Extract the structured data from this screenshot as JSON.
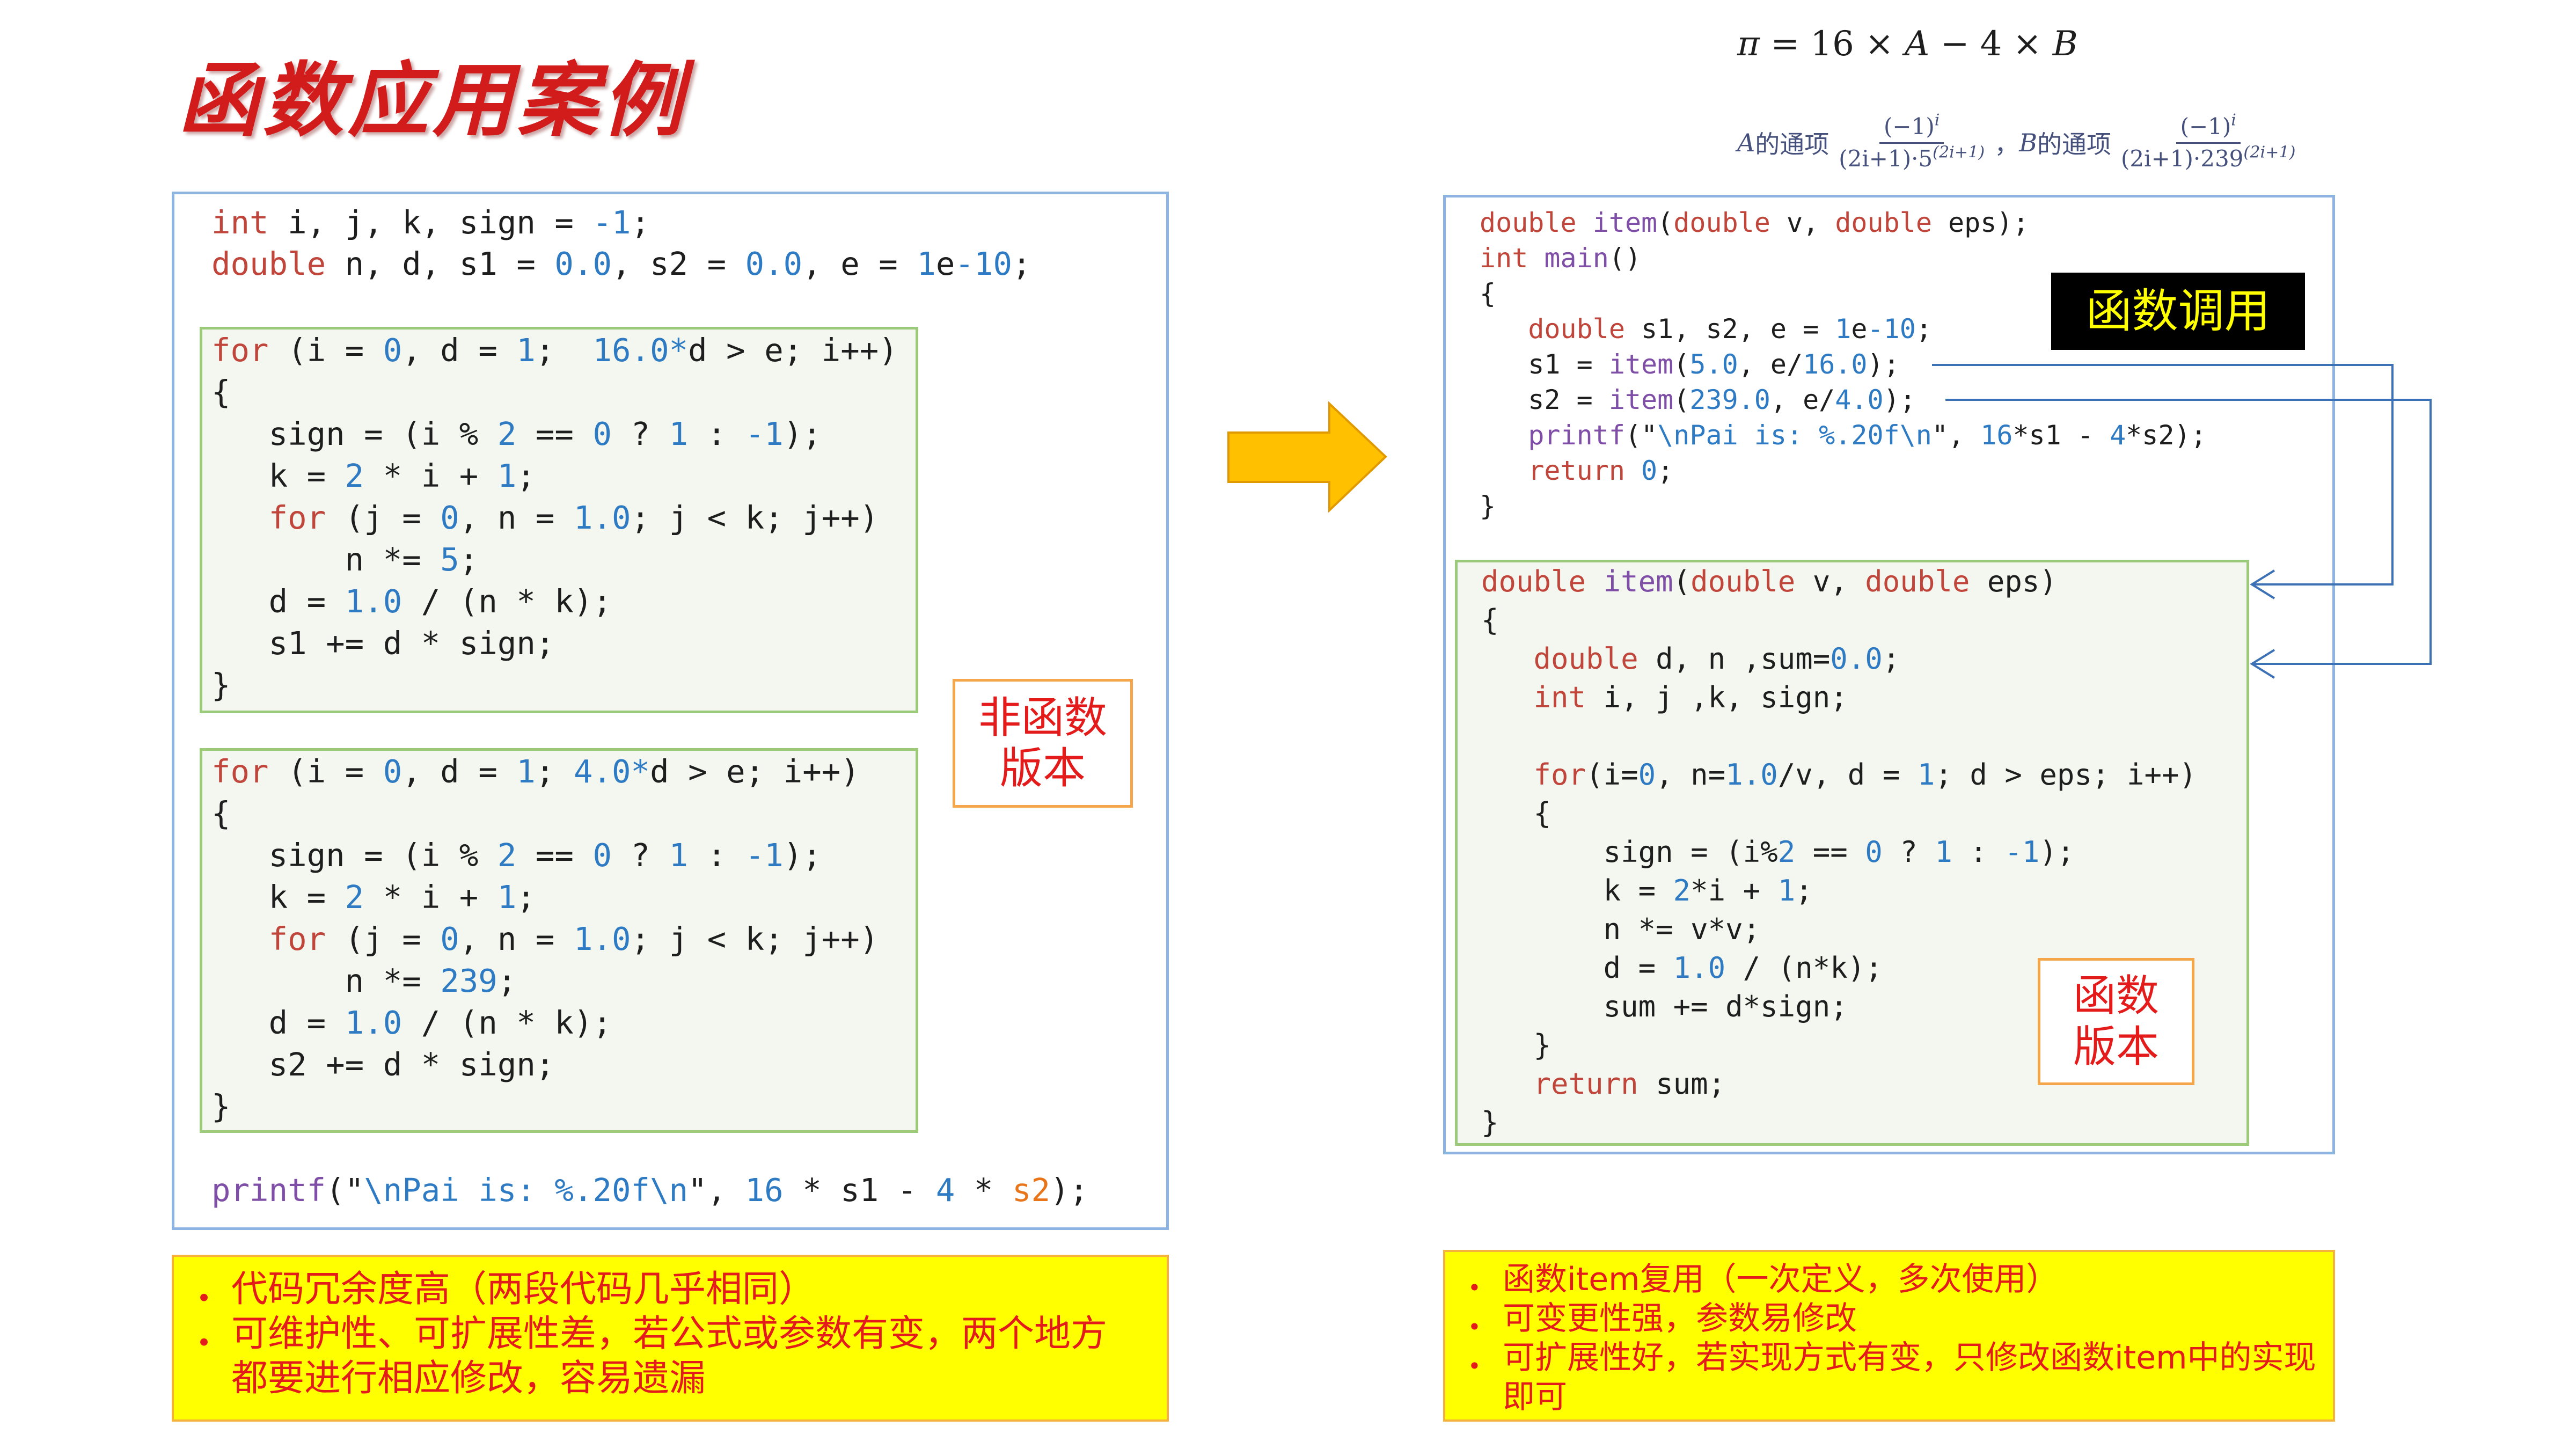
{
  "title": "函数应用案例",
  "formula": {
    "main_parts": [
      "π",
      " = 16 × ",
      "A",
      " − 4 × ",
      "B"
    ],
    "a_var": "A",
    "a_label": "的通项",
    "a_num": "(−1)",
    "a_num_sup": "i",
    "a_den": "(2i+1)·5",
    "a_den_sup": "(2i+1)",
    "separator": "，",
    "b_var": "B",
    "b_label": "的通项",
    "b_num": "(−1)",
    "b_num_sup": "i",
    "b_den": "(2i+1)·239",
    "b_den_sup": "(2i+1)"
  },
  "non_function_version": {
    "declarations": [
      [
        [
          "int",
          "#c0463c"
        ],
        " i, j, k, sign = ",
        [
          "-1",
          "#2e7bc4"
        ],
        ";"
      ],
      [
        [
          "double",
          "#c0463c"
        ],
        " n, d, s1 = ",
        [
          "0.0",
          "#2e7bc4"
        ],
        ", s2 = ",
        [
          "0.0",
          "#2e7bc4"
        ],
        ", e = ",
        [
          "1",
          "#2e7bc4"
        ],
        "e",
        [
          "-10",
          "#2e7bc4"
        ],
        ";"
      ]
    ],
    "loop_s1": [
      [
        [
          "for",
          "#c0463c"
        ],
        " (i = ",
        [
          "0",
          "#2e7bc4"
        ],
        ", d = ",
        [
          "1",
          "#2e7bc4"
        ],
        ";  ",
        [
          "16.0*",
          "#2e7bc4"
        ],
        "d > e; i++)"
      ],
      "{",
      [
        "   sign = (i % ",
        [
          "2",
          "#2e7bc4"
        ],
        " == ",
        [
          "0",
          "#2e7bc4"
        ],
        " ? ",
        [
          "1",
          "#2e7bc4"
        ],
        " : ",
        [
          "-1",
          "#2e7bc4"
        ],
        ");"
      ],
      [
        "   k = ",
        [
          "2",
          "#2e7bc4"
        ],
        " * i + ",
        [
          "1",
          "#2e7bc4"
        ],
        ";"
      ],
      [
        "   ",
        [
          "for",
          "#c0463c"
        ],
        " (j = ",
        [
          "0",
          "#2e7bc4"
        ],
        ", n = ",
        [
          "1.0",
          "#2e7bc4"
        ],
        "; j < k; j++)"
      ],
      [
        "       n *= ",
        [
          "5",
          "#2e7bc4"
        ],
        ";"
      ],
      [
        "   d = ",
        [
          "1.0",
          "#2e7bc4"
        ],
        " / (n * k);"
      ],
      "   s1 += d * sign;",
      "}"
    ],
    "loop_s2": [
      [
        [
          "for",
          "#c0463c"
        ],
        " (i = ",
        [
          "0",
          "#2e7bc4"
        ],
        ", d = ",
        [
          "1",
          "#2e7bc4"
        ],
        "; ",
        [
          "4.0*",
          "#2e7bc4"
        ],
        "d > e; i++)"
      ],
      "{",
      [
        "   sign = (i % ",
        [
          "2",
          "#2e7bc4"
        ],
        " == ",
        [
          "0",
          "#2e7bc4"
        ],
        " ? ",
        [
          "1",
          "#2e7bc4"
        ],
        " : ",
        [
          "-1",
          "#2e7bc4"
        ],
        ");"
      ],
      [
        "   k = ",
        [
          "2",
          "#2e7bc4"
        ],
        " * i + ",
        [
          "1",
          "#2e7bc4"
        ],
        ";"
      ],
      [
        "   ",
        [
          "for",
          "#c0463c"
        ],
        " (j = ",
        [
          "0",
          "#2e7bc4"
        ],
        ", n = ",
        [
          "1.0",
          "#2e7bc4"
        ],
        "; j < k; j++)"
      ],
      [
        "       n *= ",
        [
          "239",
          "#2e7bc4"
        ],
        ";"
      ],
      [
        "   d = ",
        [
          "1.0",
          "#2e7bc4"
        ],
        " / (n * k);"
      ],
      "   s2 += d * sign;",
      "}"
    ],
    "output": [
      [
        [
          "printf",
          "#7f4fa8"
        ],
        "(\"",
        [
          "\\nPai is: %.20f\\n",
          "#2e7bc4"
        ],
        "\", ",
        [
          "16",
          "#2e7bc4"
        ],
        " * s1 - ",
        [
          "4",
          "#2e7bc4"
        ],
        " * ",
        [
          "s2",
          "#e8751a"
        ],
        ");"
      ]
    ],
    "tag": [
      "非函数",
      "版本"
    ]
  },
  "function_version": {
    "main_code": [
      [
        [
          "double",
          "#c0463c"
        ],
        " ",
        [
          "item",
          "#7f4fa8"
        ],
        "(",
        [
          "double",
          "#c0463c"
        ],
        " v, ",
        [
          "double",
          "#c0463c"
        ],
        " eps);"
      ],
      [
        [
          "int",
          "#c0463c"
        ],
        " ",
        [
          "main",
          "#7f4fa8"
        ],
        "()"
      ],
      "{",
      [
        "   ",
        [
          "double",
          "#c0463c"
        ],
        " s1, s2, e = ",
        [
          "1",
          "#2e7bc4"
        ],
        "e",
        [
          "-10",
          "#2e7bc4"
        ],
        ";"
      ],
      [
        "   s1 = ",
        [
          "item",
          "#7f4fa8"
        ],
        "(",
        [
          "5.0",
          "#2e7bc4"
        ],
        ", e/",
        [
          "16.0",
          "#2e7bc4"
        ],
        ");"
      ],
      [
        "   s2 = ",
        [
          "item",
          "#7f4fa8"
        ],
        "(",
        [
          "239.0",
          "#2e7bc4"
        ],
        ", e/",
        [
          "4.0",
          "#2e7bc4"
        ],
        ");"
      ],
      [
        "   ",
        [
          "printf",
          "#7f4fa8"
        ],
        "(\"",
        [
          "\\nPai is: %.20f\\n",
          "#2e7bc4"
        ],
        "\", ",
        [
          "16",
          "#2e7bc4"
        ],
        "*s1 - ",
        [
          "4",
          "#2e7bc4"
        ],
        "*s2);"
      ],
      [
        "   ",
        [
          "return",
          "#c0463c"
        ],
        " ",
        [
          "0",
          "#2e7bc4"
        ],
        ";"
      ],
      "}"
    ],
    "call_tag": "函数调用",
    "item_code": [
      [
        [
          "double",
          "#c0463c"
        ],
        " ",
        [
          "item",
          "#7f4fa8"
        ],
        "(",
        [
          "double",
          "#c0463c"
        ],
        " v, ",
        [
          "double",
          "#c0463c"
        ],
        " eps)"
      ],
      "{",
      [
        "   ",
        [
          "double",
          "#c0463c"
        ],
        " d, n ,sum=",
        [
          "0.0",
          "#2e7bc4"
        ],
        ";"
      ],
      [
        "   ",
        [
          "int",
          "#c0463c"
        ],
        " i, j ,k, sign;"
      ],
      "",
      [
        "   ",
        [
          "for",
          "#c0463c"
        ],
        "(i=",
        [
          "0",
          "#2e7bc4"
        ],
        ", n=",
        [
          "1.0",
          "#2e7bc4"
        ],
        "/v, d = ",
        [
          "1",
          "#2e7bc4"
        ],
        "; d > eps; i++)"
      ],
      "   {",
      [
        "       sign = (i%",
        [
          "2",
          "#2e7bc4"
        ],
        " == ",
        [
          "0",
          "#2e7bc4"
        ],
        " ? ",
        [
          "1",
          "#2e7bc4"
        ],
        " : ",
        [
          "-1",
          "#2e7bc4"
        ],
        ");"
      ],
      [
        "       k = ",
        [
          "2",
          "#2e7bc4"
        ],
        "*i + ",
        [
          "1",
          "#2e7bc4"
        ],
        ";"
      ],
      "       n *= v*v;",
      [
        "       d = ",
        [
          "1.0",
          "#2e7bc4"
        ],
        " / (n*k);"
      ],
      "       sum += d*sign;",
      "   }",
      [
        "   ",
        [
          "return",
          "#c0463c"
        ],
        " sum;"
      ],
      "}"
    ],
    "tag": [
      "函数",
      "版本"
    ]
  },
  "drawbacks": {
    "items": [
      "代码冗余度高（两段代码几乎相同）",
      "可维护性、可扩展性差，若公式或参数有变，两个地方都要进行相应修改，容易遗漏"
    ]
  },
  "advantages": {
    "items": [
      "函数item复用（一次定义，多次使用）",
      "可变更性强，参数易修改",
      "可扩展性好，若实现方式有变，只修改函数item中的实现即可"
    ]
  },
  "colors": {
    "title": "#d21b1b",
    "tag_text": "#e31b1b",
    "tag_border": "#f5a54a",
    "call_tag_bg": "#000000",
    "call_tag_text": "#ffff00",
    "note_bg": "#ffff00",
    "note_text": "#e31b1b",
    "panel_border": "#8db4e2",
    "block_border": "#9bcb7a",
    "connector": "#3c72b5",
    "arrow_fill": "#ffc000"
  }
}
